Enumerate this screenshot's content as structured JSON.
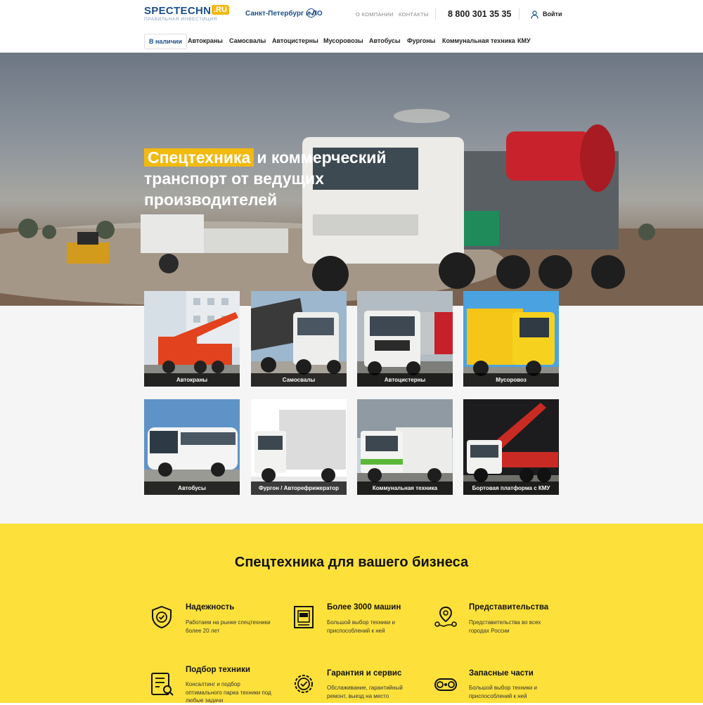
{
  "header": {
    "logo_main": "SPECTECHNIKA",
    "logo_ru": ".RU",
    "logo_sub": "правильная инвестиция",
    "city": "Санкт-Петербург и ЛО",
    "links": [
      "О КОМПАНИИ",
      "КОНТАКТЫ"
    ],
    "phone": "8 800 301 35 35",
    "login": "Войти"
  },
  "nav": {
    "items": [
      "В наличии",
      "Автокраны",
      "Самосвалы",
      "Автоцистерны",
      "Мусоровозы",
      "Автобусы",
      "Фургоны",
      "Коммунальная техника",
      "КМУ"
    ]
  },
  "hero": {
    "highlight": "Спецтехника",
    "title_rest": "и коммерческий транспорт от ведущих производителей"
  },
  "categories": [
    "Автокраны",
    "Самосвалы",
    "Автоцистерны",
    "Мусоровоз",
    "Автобусы",
    "Фургон / Авторефрижератор",
    "Коммунальная техника",
    "Бортовая платформа с КМУ"
  ],
  "business": {
    "title": "Спецтехника для вашего бизнеса",
    "features": [
      {
        "title": "Надежность",
        "text": "Работаем на рынке спецтехники более 20 лет",
        "icon": "shield-check-icon"
      },
      {
        "title": "Более 3000 машин",
        "text": "Большой выбор техники и приспособлений к ней",
        "icon": "catalog-truck-icon"
      },
      {
        "title": "Представительства",
        "text": "Представительства во всех городах России",
        "icon": "map-pins-icon"
      },
      {
        "title": "Подбор техники",
        "text": "Консалтинг и подбор оптимального парка техники под любые задачи",
        "icon": "checklist-search-icon"
      },
      {
        "title": "Гарантия и сервис",
        "text": "Обслаживание, гарантийный ремонт, выезд на место",
        "icon": "gear-check-icon"
      },
      {
        "title": "Запасные части",
        "text": "Большой выбор техники и приспособлений к ней",
        "icon": "crawler-track-icon"
      }
    ]
  },
  "colors": {
    "accent": "#f2b90f",
    "brand": "#1b4f8a",
    "biz_bg": "#fde13a"
  }
}
